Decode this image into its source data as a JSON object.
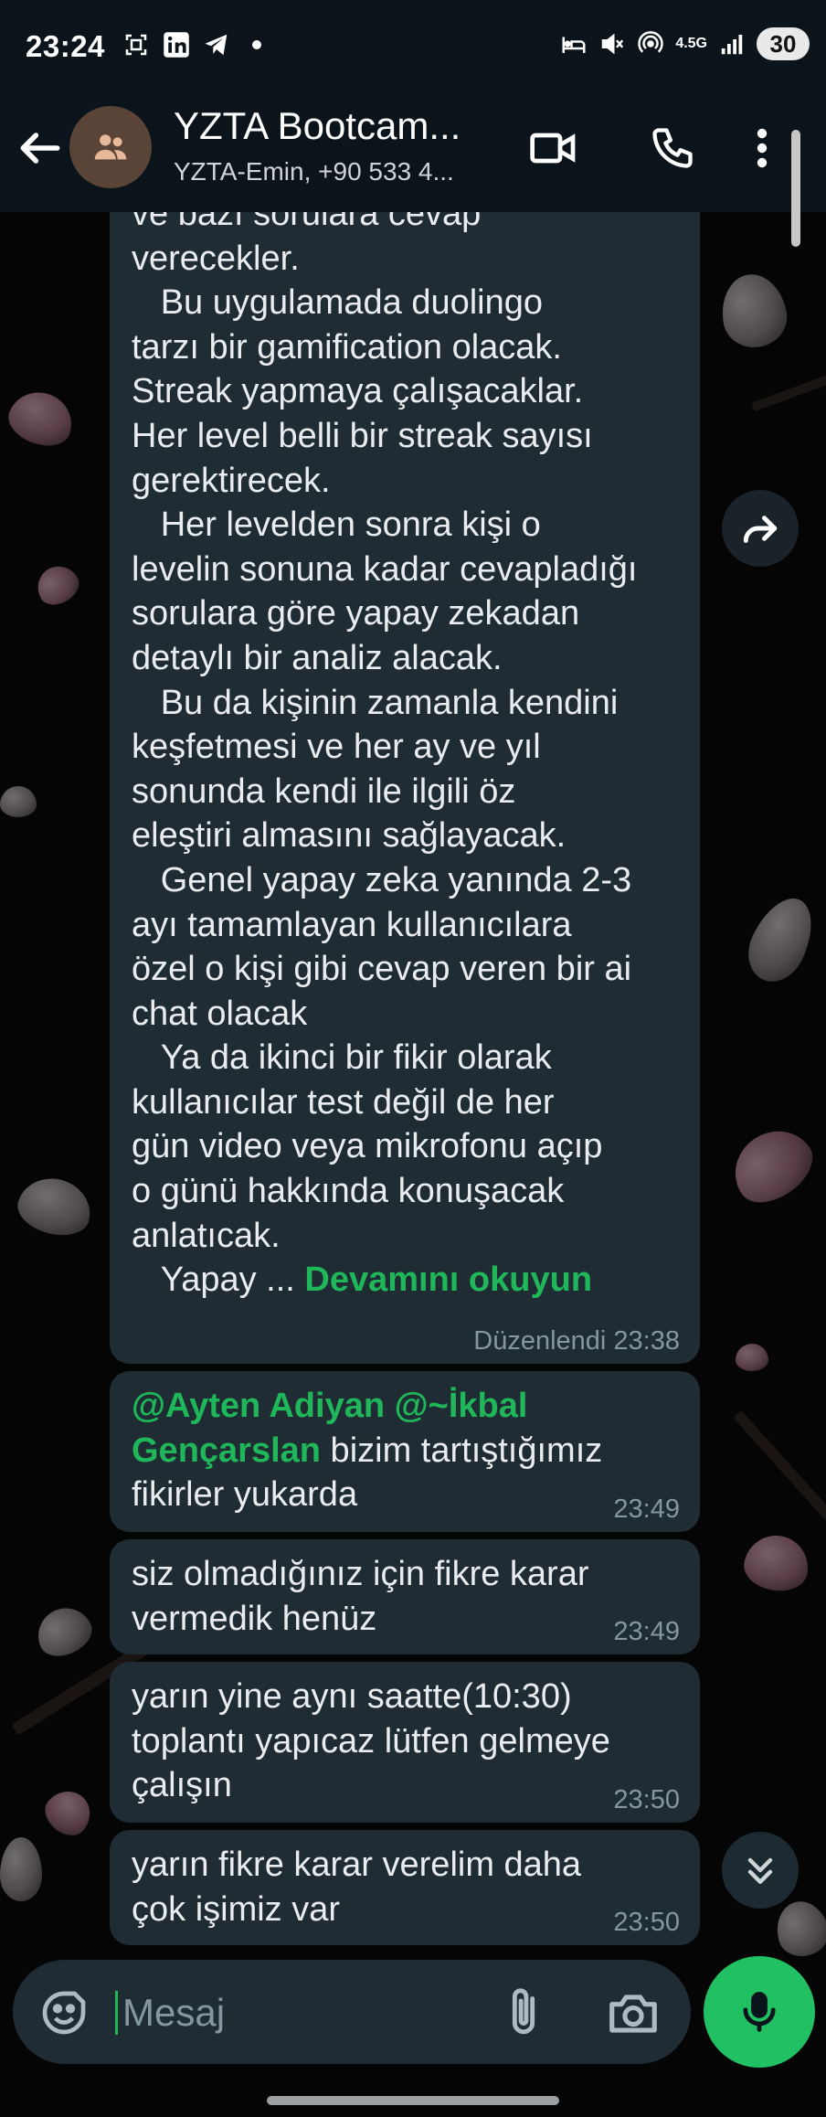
{
  "status_bar": {
    "time": "23:24",
    "network": "4.5G",
    "battery": "30"
  },
  "header": {
    "title": "YZTA Bootcam...",
    "subtitle": "YZTA-Emin, +90 533 4..."
  },
  "messages": [
    {
      "text": "ve bazı sorulara cevap\nverecekler.\n   Bu uygulamada duolingo\ntarzı bir gamification olacak.\nStreak yapmaya çalışacaklar.\nHer level belli bir streak sayısı\ngerektirecek.\n   Her levelden sonra kişi o\nlevelin sonuna kadar cevapladığı\nsorulara göre yapay zekadan\ndetaylı bir analiz alacak.\n   Bu da kişinin zamanla kendini\nkeşfetmesi ve her ay ve yıl\nsonunda kendi ile ilgili öz\neleştiri almasını sağlayacak.\n   Genel yapay zeka yanında 2-3\nayı tamamlayan kullanıcılara\nözel o kişi gibi cevap veren bir ai\nchat olacak\n   Ya da ikinci bir fikir olarak\nkullanıcılar test değil de her\ngün video veya mikrofonu açıp\no günü hakkında konuşacak\nanlatıcak.\n   Yapay ... ",
      "read_more": "Devamını okuyun",
      "meta": "Düzenlendi 23:38"
    },
    {
      "mention": "@Ayten Adiyan @~İkbal\nGençarslan",
      "text": " bizim tartıştığımız\nfikirler yukarda",
      "meta": "23:49"
    },
    {
      "text": "siz olmadığınız için fikre karar\nvermedik henüz",
      "meta": "23:49"
    },
    {
      "text": "yarın yine aynı saatte(10:30)\ntoplantı yapıcaz lütfen gelmeye\nçalışın",
      "meta": "23:50"
    },
    {
      "text": "yarın fikre karar verelim daha\nçok işimiz var",
      "meta": "23:50"
    }
  ],
  "composer": {
    "placeholder": "Mesaj"
  },
  "colors": {
    "accent": "#1fb759",
    "bubble": "#1f2c34",
    "meta": "#8696a0",
    "mic": "#21c063"
  }
}
